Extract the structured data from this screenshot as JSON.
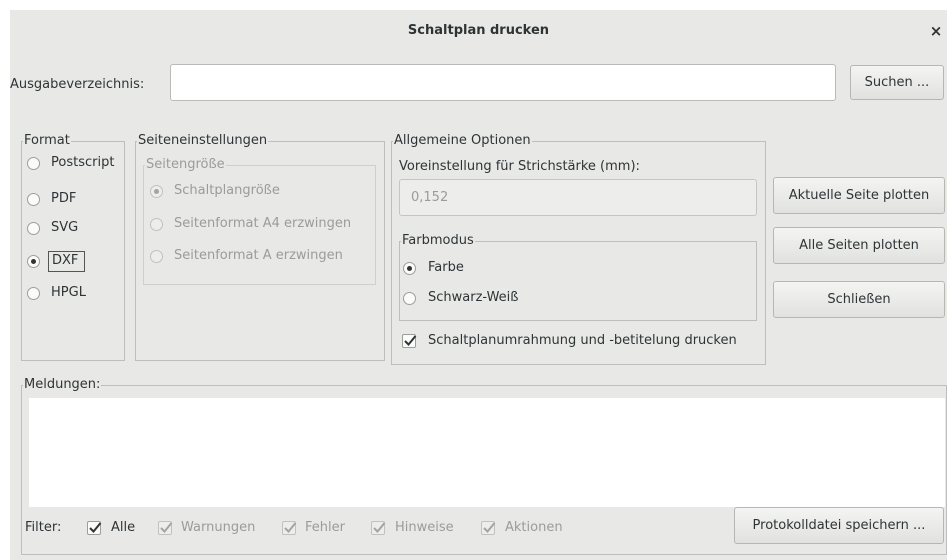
{
  "window": {
    "title": "Schaltplan drucken",
    "close_glyph": "×"
  },
  "output": {
    "label": "Ausgabeverzeichnis:",
    "value": "",
    "browse_label": "Suchen ..."
  },
  "format": {
    "legend": "Format",
    "options": [
      {
        "label": "Postscript",
        "selected": false
      },
      {
        "label": "PDF",
        "selected": false
      },
      {
        "label": "SVG",
        "selected": false
      },
      {
        "label": "DXF",
        "selected": true
      },
      {
        "label": "HPGL",
        "selected": false
      }
    ]
  },
  "page_settings": {
    "legend": "Seiteneinstellungen",
    "size_legend": "Seitengröße",
    "options": [
      {
        "label": "Schaltplangröße",
        "selected": true
      },
      {
        "label": "Seitenformat A4 erzwingen",
        "selected": false
      },
      {
        "label": "Seitenformat A erzwingen",
        "selected": false
      }
    ]
  },
  "general": {
    "legend": "Allgemeine Optionen",
    "line_width_label": "Voreinstellung für Strichstärke (mm):",
    "line_width_value": "0,152",
    "color_mode": {
      "legend": "Farbmodus",
      "options": [
        {
          "label": "Farbe",
          "selected": true
        },
        {
          "label": "Schwarz-Weiß",
          "selected": false
        }
      ]
    },
    "frame_checkbox": {
      "label": "Schaltplanumrahmung und -betitelung drucken",
      "checked": true
    }
  },
  "actions": {
    "plot_current": "Aktuelle Seite plotten",
    "plot_all": "Alle Seiten plotten",
    "close": "Schließen"
  },
  "messages": {
    "legend": "Meldungen:",
    "filter_label": "Filter:",
    "filters": [
      {
        "label": "Alle",
        "checked": true,
        "enabled": true
      },
      {
        "label": "Warnungen",
        "checked": true,
        "enabled": false
      },
      {
        "label": "Fehler",
        "checked": true,
        "enabled": false
      },
      {
        "label": "Hinweise",
        "checked": true,
        "enabled": false
      },
      {
        "label": "Aktionen",
        "checked": true,
        "enabled": false
      }
    ],
    "save_log": "Protokolldatei speichern ..."
  },
  "icons": {
    "close": "close-icon",
    "check": "checkmark-icon"
  }
}
